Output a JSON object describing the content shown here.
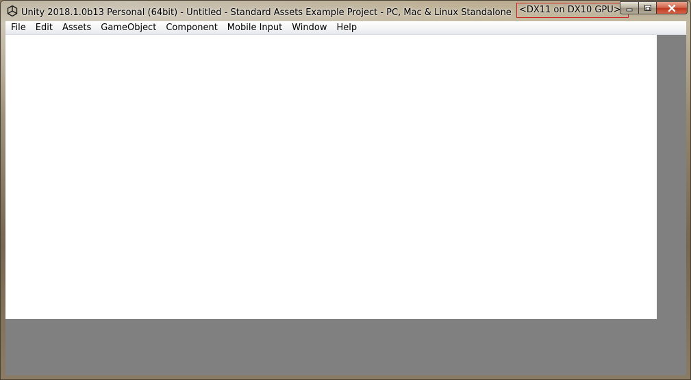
{
  "window": {
    "title": "Unity 2018.1.0b13 Personal (64bit) - Untitled - Standard Assets Example Project - PC, Mac & Linux Standalone",
    "gpu_label": "<DX11 on DX10 GPU>",
    "app_icon": "unity-logo-icon",
    "controls": {
      "minimize_icon": "minimize-icon",
      "maximize_icon": "maximize-icon",
      "close_icon": "close-icon"
    }
  },
  "menu": {
    "items": [
      {
        "label": "File"
      },
      {
        "label": "Edit"
      },
      {
        "label": "Assets"
      },
      {
        "label": "GameObject"
      },
      {
        "label": "Component"
      },
      {
        "label": "Mobile Input"
      },
      {
        "label": "Window"
      },
      {
        "label": "Help"
      }
    ]
  },
  "colors": {
    "highlight_border": "#d02424",
    "client_background": "#808080",
    "panel_background": "#ffffff",
    "close_button": "#c0391f"
  }
}
